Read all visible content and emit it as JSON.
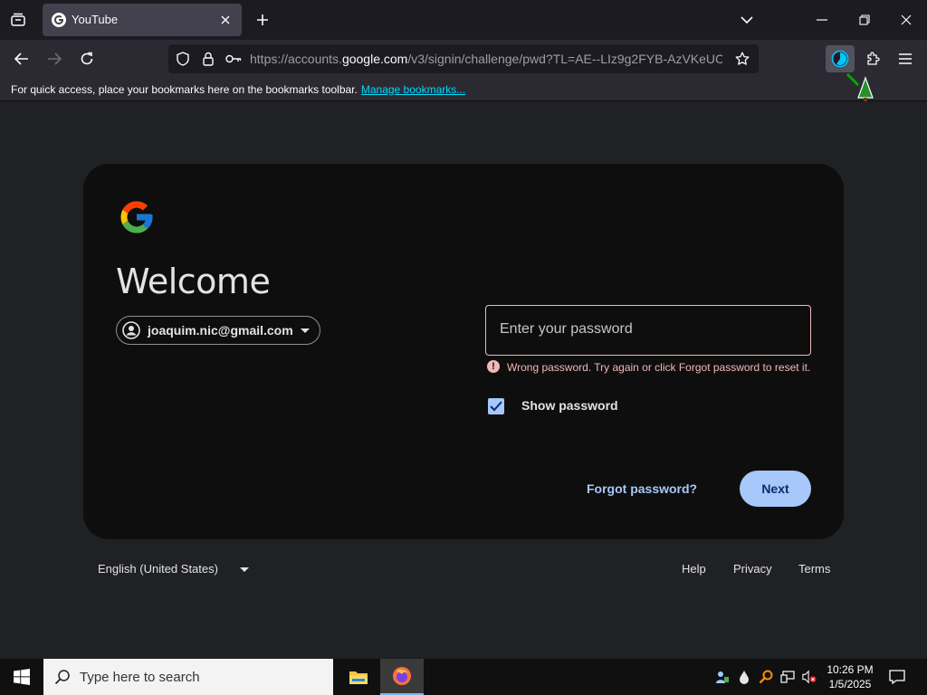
{
  "browser": {
    "tab": {
      "title": "YouTube"
    },
    "url": {
      "prefix": "https://accounts.",
      "domain": "google.com",
      "path": "/v3/signin/challenge/pwd?TL=AE--LIz9g2FYB-AzVKeUCE"
    },
    "bookmarks_text": "For quick access, place your bookmarks here on the bookmarks toolbar.",
    "bookmarks_link": "Manage bookmarks..."
  },
  "signin": {
    "heading": "Welcome",
    "email": "joaquim.nic@gmail.com",
    "password_placeholder": "Enter your password",
    "error": "Wrong password. Try again or click Forgot password to reset it.",
    "show_password_label": "Show password",
    "show_password_checked": true,
    "forgot_label": "Forgot password?",
    "next_label": "Next"
  },
  "footer": {
    "language": "English (United States)",
    "links": {
      "help": "Help",
      "privacy": "Privacy",
      "terms": "Terms"
    }
  },
  "taskbar": {
    "search_placeholder": "Type here to search",
    "time": "10:26 PM",
    "date": "1/5/2025"
  },
  "colors": {
    "accent": "#a8c7fa",
    "error": "#f2b8b5",
    "card_bg": "#0e0e0f",
    "page_bg": "#202124"
  },
  "icons": {
    "tab_list": "tab-list-icon",
    "back": "back-arrow-icon",
    "forward": "forward-arrow-icon",
    "reload": "reload-icon",
    "shield": "shield-icon",
    "lock": "lock-icon",
    "key": "key-icon",
    "star": "star-icon",
    "extensions": "puzzle-icon",
    "menu": "hamburger-menu-icon"
  }
}
